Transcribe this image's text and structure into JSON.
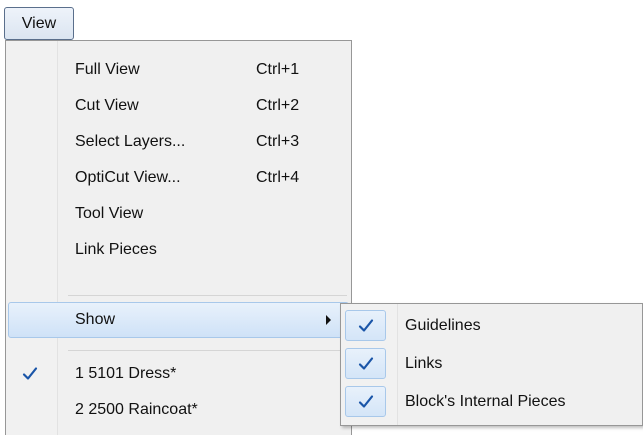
{
  "menubar": {
    "view_label": "View"
  },
  "menu": {
    "items": [
      {
        "label": "Full View",
        "shortcut": "Ctrl+1"
      },
      {
        "label": "Cut View",
        "shortcut": "Ctrl+2"
      },
      {
        "label": "Select Layers...",
        "shortcut": "Ctrl+3"
      },
      {
        "label": "OptiCut View...",
        "shortcut": "Ctrl+4"
      },
      {
        "label": "Tool View"
      },
      {
        "label": "Link Pieces"
      },
      {
        "label": "Show",
        "has_submenu": true,
        "highlighted": true
      },
      {
        "label": "1 5101 Dress*",
        "checked": true
      },
      {
        "label": "2 2500 Raincoat*"
      }
    ]
  },
  "submenu": {
    "items": [
      {
        "label": "Guidelines",
        "checked": true
      },
      {
        "label": "Links",
        "checked": true
      },
      {
        "label": "Block's Internal Pieces",
        "checked": true
      }
    ]
  },
  "colors": {
    "highlight": "#cfe2f7",
    "check": "#1a55a8",
    "menu_bg": "#f0f0f0"
  },
  "icons": {
    "check": "checkmark-icon",
    "submenu_arrow": "chevron-right-icon"
  }
}
